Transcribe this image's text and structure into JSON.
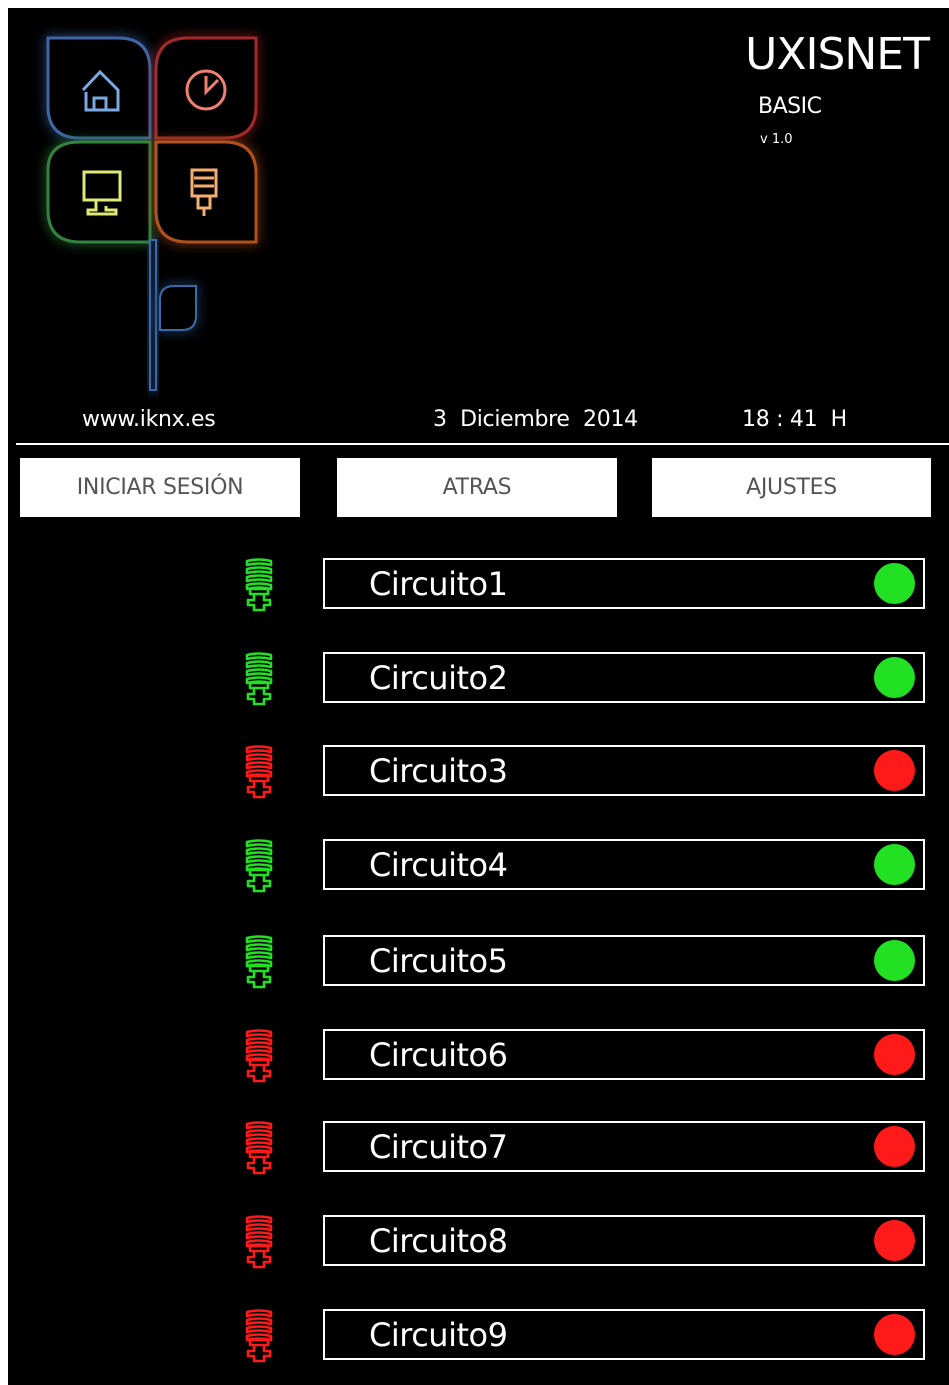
{
  "header": {
    "brand_title": "UXISNET",
    "edition": "BASIC",
    "version": "v 1.0",
    "website": "www.iknx.es",
    "date": "3  Diciembre  2014",
    "time": "18 : 41  H"
  },
  "colors": {
    "background": "#000000",
    "on": "#22e022",
    "off": "#ff1a1a",
    "logo_home": "#6e9fd8",
    "logo_clock": "#e56b5a",
    "logo_screen": "#d8e070",
    "logo_bulb": "#f0a060"
  },
  "toolbar": {
    "login_label": "INICIAR SESIÓN",
    "back_label": "ATRAS",
    "settings_label": "AJUSTES"
  },
  "circuits": [
    {
      "label": "Circuito1",
      "state": "on",
      "icon": "lightbulb-icon"
    },
    {
      "label": "Circuito2",
      "state": "on",
      "icon": "lightbulb-icon"
    },
    {
      "label": "Circuito3",
      "state": "off",
      "icon": "lightbulb-icon"
    },
    {
      "label": "Circuito4",
      "state": "on",
      "icon": "lightbulb-icon"
    },
    {
      "label": "Circuito5",
      "state": "on",
      "icon": "lightbulb-icon"
    },
    {
      "label": "Circuito6",
      "state": "off",
      "icon": "lightbulb-icon"
    },
    {
      "label": "Circuito7",
      "state": "off",
      "icon": "lightbulb-icon"
    },
    {
      "label": "Circuito8",
      "state": "off",
      "icon": "lightbulb-icon"
    },
    {
      "label": "Circuito9",
      "state": "off",
      "icon": "lightbulb-icon"
    }
  ]
}
